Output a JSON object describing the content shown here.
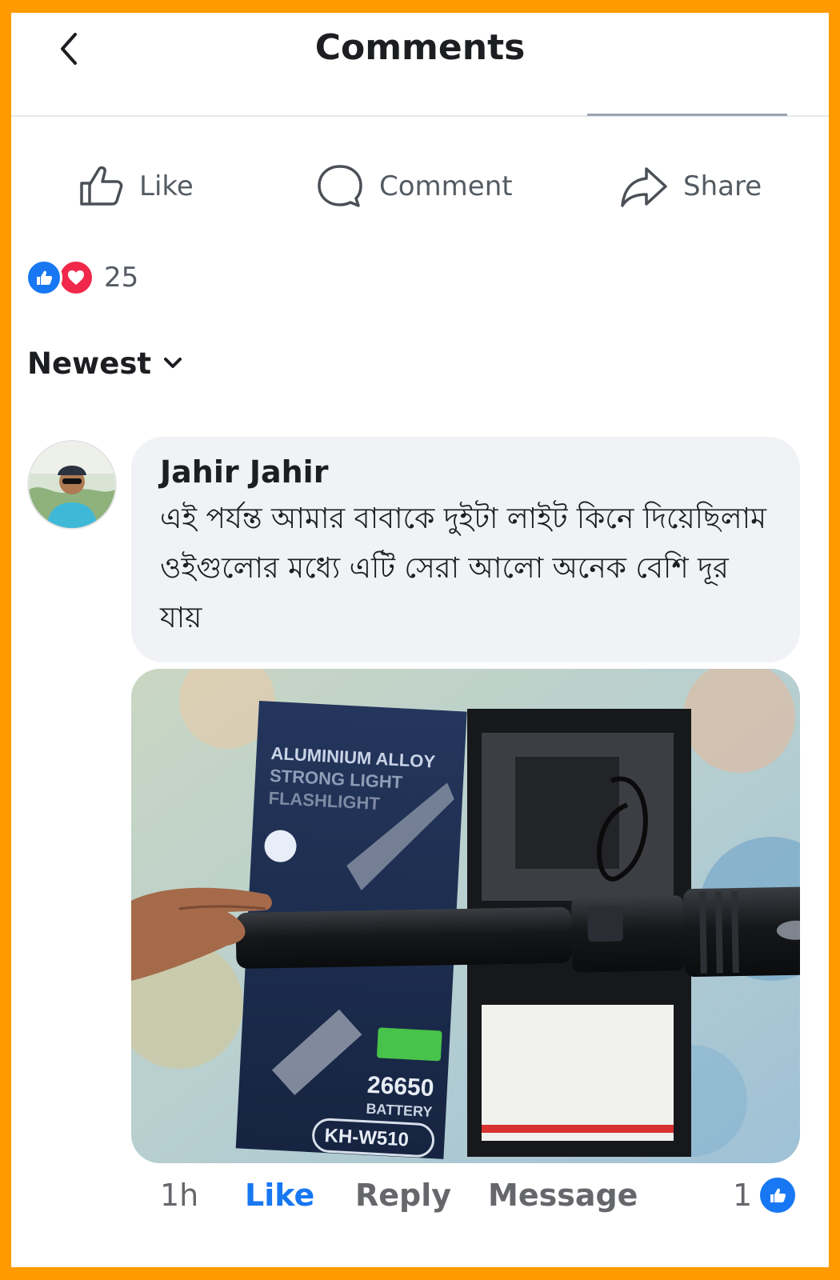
{
  "header": {
    "title": "Comments",
    "back_icon": "chevron-left-icon"
  },
  "post_actions": {
    "like_label": "Like",
    "comment_label": "Comment",
    "share_label": "Share"
  },
  "reactions": {
    "count": "25",
    "types": [
      "like",
      "love"
    ]
  },
  "sort": {
    "label": "Newest"
  },
  "comment": {
    "author": "Jahir Jahir",
    "text": "এই পর্যন্ত আমার বাবাকে দুইটা লাইট কিনে দিয়েছিলাম ওইগুলোর মধ্যে এটি সেরা আলো অনেক বেশি দূর যায়",
    "photo": {
      "box_line1": "ALUMINIUM ALLOY",
      "box_line2": "STRONG LIGHT",
      "box_line3": "FLASHLIGHT",
      "battery_number": "26650",
      "battery_label": "BATTERY",
      "model": "KH-W510"
    },
    "time": "1h",
    "like_label": "Like",
    "reply_label": "Reply",
    "message_label": "Message",
    "like_count": "1"
  },
  "colors": {
    "accent": "#1877f2",
    "love": "#f0284a",
    "frame": "#ff9a00",
    "bubble": "#f0f2f5",
    "muted_text": "#65676b"
  }
}
